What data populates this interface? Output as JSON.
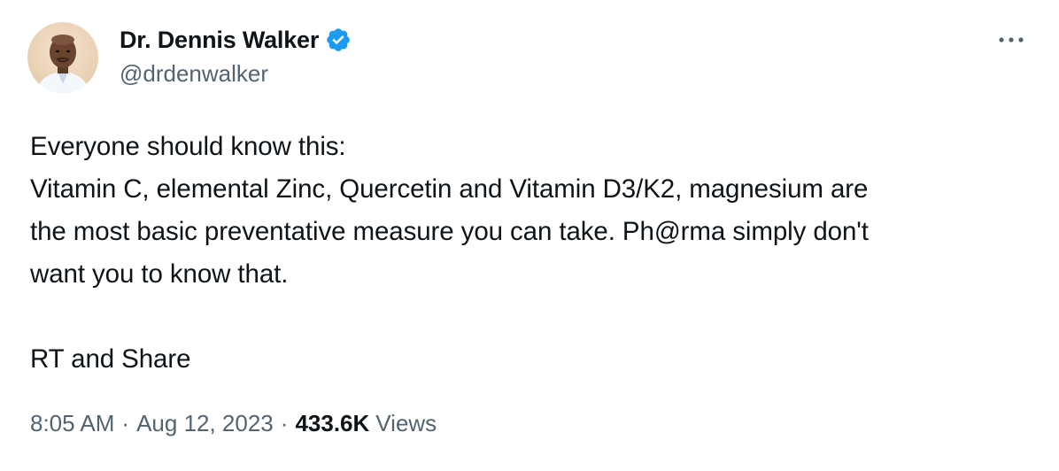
{
  "author": {
    "name": "Dr. Dennis Walker",
    "handle": "@drdenwalker",
    "verified": true,
    "verified_color": "#1d9bf0"
  },
  "tweet": {
    "lines": [
      "Everyone should know this:",
      "Vitamin C, elemental Zinc, Quercetin and Vitamin D3/K2, magnesium are",
      "the most basic preventative measure you can take. Ph@rma simply don't",
      "want you to know that.",
      "",
      "RT and Share"
    ]
  },
  "meta": {
    "time": "8:05 AM",
    "separator": "·",
    "date": "Aug 12, 2023",
    "views_count": "433.6K",
    "views_label": "Views"
  },
  "icons": {
    "more": "more-horizontal-icon",
    "verified": "verified-badge-icon"
  }
}
